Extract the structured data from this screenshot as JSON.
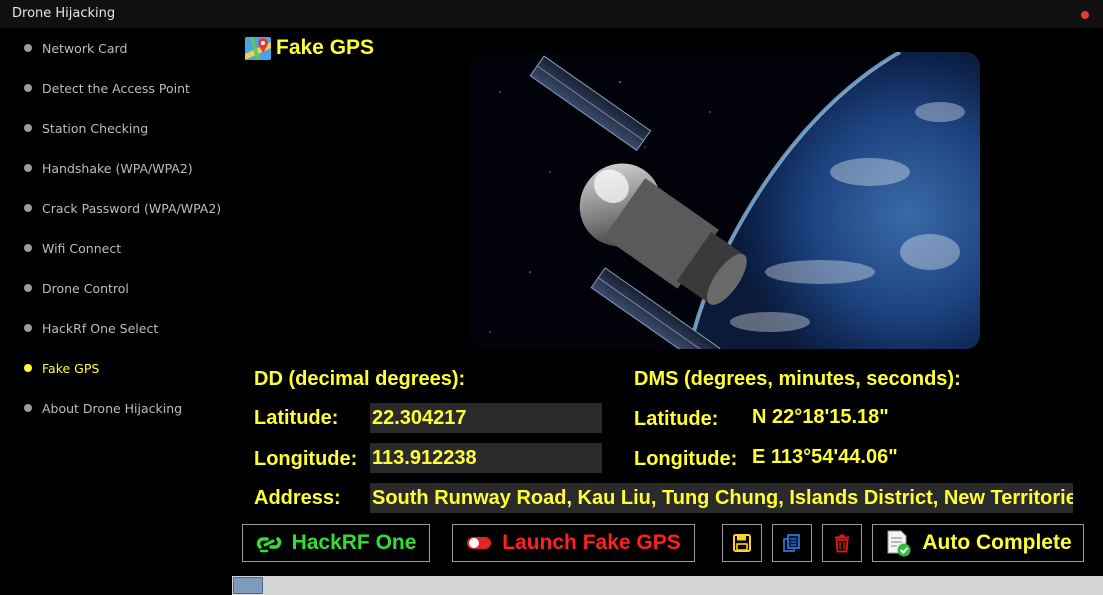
{
  "window": {
    "title": "Drone Hijacking"
  },
  "sidebar": {
    "items": [
      {
        "label": "Network Card"
      },
      {
        "label": "Detect the Access Point"
      },
      {
        "label": "Station Checking"
      },
      {
        "label": "Handshake (WPA/WPA2)"
      },
      {
        "label": "Crack Password (WPA/WPA2)"
      },
      {
        "label": "Wifi Connect"
      },
      {
        "label": "Drone Control"
      },
      {
        "label": "HackRf One Select"
      },
      {
        "label": "Fake GPS",
        "active": true
      },
      {
        "label": "About Drone Hijacking"
      }
    ]
  },
  "main": {
    "title": "Fake GPS",
    "dd": {
      "heading": "DD (decimal degrees):",
      "latitude_label": "Latitude:",
      "latitude_value": "22.304217",
      "longitude_label": "Longitude:",
      "longitude_value": "113.912238"
    },
    "dms": {
      "heading": "DMS (degrees, minutes, seconds):",
      "latitude_label": "Latitude:",
      "latitude_value": "N 22°18'15.18\"",
      "longitude_label": "Longitude:",
      "longitude_value": "E 113°54'44.06\""
    },
    "address": {
      "label": "Address:",
      "value": "South Runway Road, Kau Liu, Tung Chung, Islands District, New Territories"
    }
  },
  "toolbar": {
    "hackrf_label": "HackRF One",
    "launch_label": "Launch Fake GPS",
    "auto_label": "Auto Complete"
  },
  "colors": {
    "accent": "#ffff33",
    "hackrf_text": "#33dd33",
    "launch_text": "#ff2020",
    "save_icon": "#ffd21f",
    "copy_icon": "#2f6fd6",
    "delete_icon": "#e01818"
  },
  "icons": {
    "title": "map-pin-icon",
    "hackrf": "link-icon",
    "launch": "toggle-icon",
    "save": "floppy-disk-icon",
    "copy": "copy-icon",
    "delete": "trash-icon",
    "auto": "document-check-icon"
  }
}
